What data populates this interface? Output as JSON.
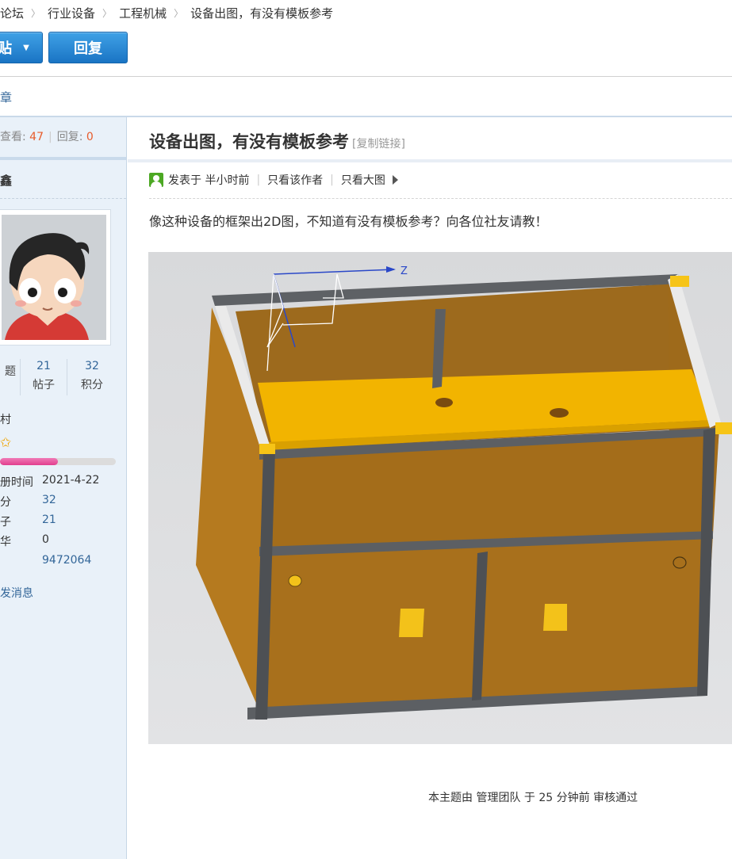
{
  "breadcrumb": [
    "论坛",
    "行业设备",
    "工程机械",
    "设备出图，有没有模板参考"
  ],
  "actions": {
    "post_label": "贴",
    "reply_label": "回复"
  },
  "subnav": {
    "label": "章"
  },
  "thread_stats": {
    "views_label": "查看:",
    "views": "47",
    "replies_label": "回复:",
    "replies": "0"
  },
  "author": {
    "name": "鑫"
  },
  "profile_stats": [
    {
      "value": "",
      "label": "题"
    },
    {
      "value": "21",
      "label": "帖子"
    },
    {
      "value": "32",
      "label": "积分"
    }
  ],
  "profile": {
    "rank": "村",
    "level_progress": 0.5,
    "info": [
      {
        "key": "册时间",
        "value": "2021-4-22",
        "link": false
      },
      {
        "key": "分",
        "value": "32",
        "link": true
      },
      {
        "key": "子",
        "value": "21",
        "link": true
      },
      {
        "key": "华",
        "value": "0",
        "link": false
      },
      {
        "key": "",
        "value": "9472064",
        "link": true
      }
    ],
    "message_label": "发消息"
  },
  "post": {
    "title": "设备出图，有没有模板参考",
    "copy_link": "[复制链接]",
    "posted": "发表于 半小时前",
    "author_only": "只看该作者",
    "large_images": "只看大图",
    "body": "像这种设备的框架出2D图，不知道有没有模板参考？向各位社友请教！"
  },
  "figure": {
    "axis_label": "Z"
  },
  "moderation": {
    "note": "本主题由 管理团队 于 25 分钟前 审核通过"
  },
  "colors": {
    "link": "#336699",
    "highlight": "#e85c2c",
    "button": "#1a74c4",
    "online": "#4ca823"
  }
}
